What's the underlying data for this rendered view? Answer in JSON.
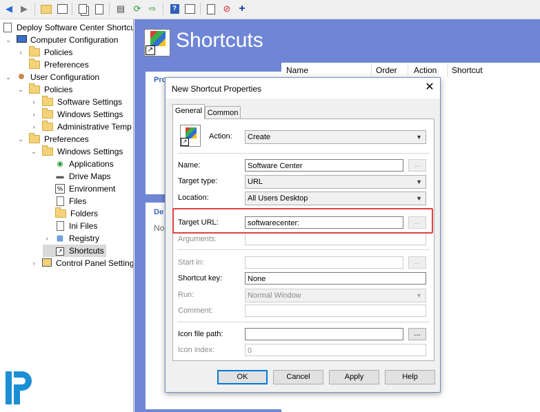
{
  "toolbar": {
    "icons": [
      "back-icon",
      "forward-icon",
      "up-folder-icon",
      "show-hide-tree-icon",
      "copy-icon",
      "paste-icon",
      "print-icon",
      "refresh-icon",
      "export-icon",
      "help-icon",
      "properties-icon",
      "new-item-icon",
      "stop-icon",
      "add-icon"
    ]
  },
  "tree": {
    "items": [
      {
        "label": "Deploy Software Center Shortcut",
        "icon": "gpo-icon",
        "expander": "none"
      },
      {
        "label": "Computer Configuration",
        "icon": "computer-icon",
        "expander": "down"
      },
      {
        "label": "Policies",
        "icon": "folder-icon",
        "expander": "right"
      },
      {
        "label": "Preferences",
        "icon": "folder-icon",
        "expander": "none"
      },
      {
        "label": "User Configuration",
        "icon": "user-icon",
        "expander": "down"
      },
      {
        "label": "Policies",
        "icon": "folder-icon",
        "expander": "down"
      },
      {
        "label": "Software Settings",
        "icon": "folder-icon",
        "expander": "right"
      },
      {
        "label": "Windows Settings",
        "icon": "folder-icon",
        "expander": "right"
      },
      {
        "label": "Administrative Temp",
        "icon": "folder-icon",
        "expander": "right"
      },
      {
        "label": "Preferences",
        "icon": "folder-icon",
        "expander": "down"
      },
      {
        "label": "Windows Settings",
        "icon": "folder-icon",
        "expander": "down"
      },
      {
        "label": "Applications",
        "icon": "applications-icon",
        "expander": "none"
      },
      {
        "label": "Drive Maps",
        "icon": "drive-maps-icon",
        "expander": "none"
      },
      {
        "label": "Environment",
        "icon": "environment-icon",
        "expander": "none"
      },
      {
        "label": "Files",
        "icon": "files-icon",
        "expander": "none"
      },
      {
        "label": "Folders",
        "icon": "folders-icon",
        "expander": "none"
      },
      {
        "label": "Ini Files",
        "icon": "ini-files-icon",
        "expander": "none"
      },
      {
        "label": "Registry",
        "icon": "registry-icon",
        "expander": "right"
      },
      {
        "label": "Shortcuts",
        "icon": "shortcut-icon",
        "expander": "none"
      },
      {
        "label": "Control Panel Setting",
        "icon": "control-panel-icon",
        "expander": "right"
      }
    ]
  },
  "pane": {
    "title": "Shortcuts",
    "columns": [
      "Name",
      "Order",
      "Action",
      "Shortcut"
    ],
    "card1_label": "Pro",
    "card2_label": "De",
    "card2_text": "No"
  },
  "dialog": {
    "title": "New Shortcut Properties",
    "close": "✕",
    "tabs": [
      "General",
      "Common"
    ],
    "action_label": "Action:",
    "action_value": "Create",
    "name_label": "Name:",
    "name_value": "Software Center",
    "target_type_label": "Target type:",
    "target_type_value": "URL",
    "location_label": "Location:",
    "location_value": "All Users Desktop",
    "target_url_label": "Target URL:",
    "target_url_value": "softwarecenter:",
    "arguments_label": "Arguments:",
    "start_in_label": "Start in:",
    "shortcut_key_label": "Shortcut key:",
    "shortcut_key_value": "None",
    "run_label": "Run:",
    "run_value": "Normal Window",
    "comment_label": "Comment:",
    "icon_path_label": "Icon file path:",
    "icon_index_label": "Icon index:",
    "icon_index_value": "0",
    "ellipsis": "...",
    "buttons": {
      "ok": "OK",
      "cancel": "Cancel",
      "apply": "Apply",
      "help": "Help"
    }
  },
  "colors": {
    "pane_bg": "#6f86d6",
    "highlight": "#e04040",
    "ok_border": "#0078d7"
  }
}
